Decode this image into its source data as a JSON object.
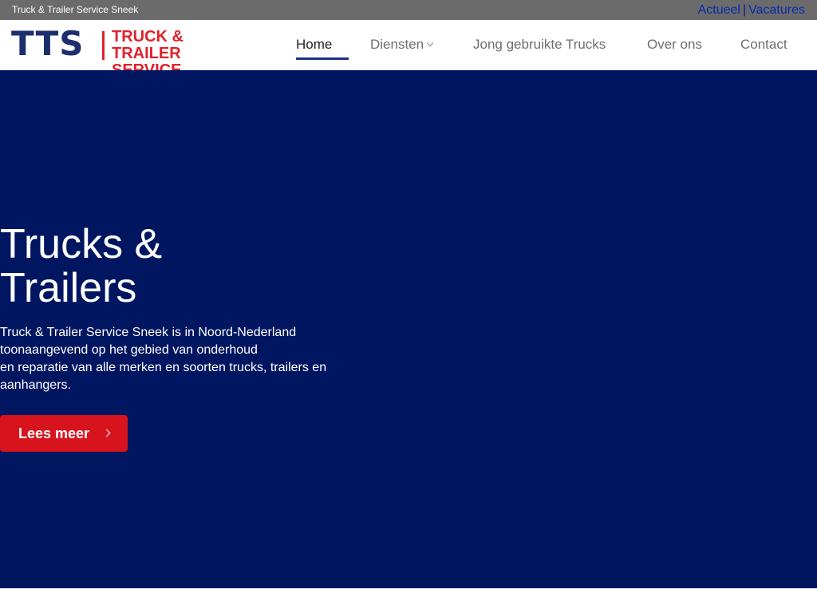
{
  "topbar": {
    "site_name": "Truck & Trailer Service Sneek",
    "links": [
      "Actueel",
      "Vacatures"
    ],
    "separator": "|"
  },
  "logo": {
    "mark": "TTS",
    "line1": "TRUCK & TRAILER",
    "line2": "SERVICE"
  },
  "nav": {
    "items": [
      {
        "label": "Home",
        "active": true
      },
      {
        "label": "Diensten",
        "has_dropdown": true,
        "icon": "chevron-down-icon"
      },
      {
        "label": "Jong gebruikte Trucks"
      },
      {
        "label": "Over ons"
      },
      {
        "label": "Contact"
      }
    ]
  },
  "hero": {
    "title_line1": "Trucks &",
    "title_line2": "Trailers",
    "intro_lines": [
      "Truck & Trailer Service Sneek is in Noord-Nederland",
      "toonaangevend op het gebied van onderhoud",
      "en reparatie van alle merken en soorten trucks, trailers en",
      "aanhangers."
    ],
    "cta_label": "Lees meer",
    "cta_icon": "chevron-right-icon"
  },
  "colors": {
    "hero_bg": "#001660",
    "accent_red": "#d7141e",
    "brand_blue": "#1b2f6e",
    "topbar_bg": "#6b6b6b"
  }
}
